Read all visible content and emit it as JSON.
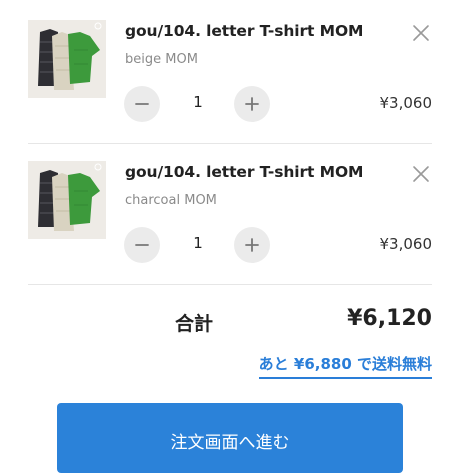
{
  "cart": {
    "items": [
      {
        "title": "gou/104. letter T-shirt MOM",
        "variant": "beige MOM",
        "quantity": "1",
        "price": "¥3,060",
        "image_icon": "product-thumbnail-tshirts"
      },
      {
        "title": "gou/104. letter T-shirt MOM",
        "variant": "charcoal MOM",
        "quantity": "1",
        "price": "¥3,060",
        "image_icon": "product-thumbnail-tshirts"
      }
    ],
    "remove_icon": "close-icon",
    "minus_icon": "minus-icon",
    "plus_icon": "plus-icon"
  },
  "summary": {
    "total_label": "合計",
    "total_amount": "¥6,120",
    "free_shipping_note": "あと ¥6,880 で送料無料"
  },
  "checkout": {
    "button_label": "注文画面へ進む"
  },
  "colors": {
    "accent_blue": "#2b82d9",
    "link_blue": "#2a7ed8",
    "button_gray": "#ebebeb",
    "shirt_green": "#3d9a3c",
    "shirt_charcoal": "#2e2e33",
    "shirt_beige": "#d9d3c1"
  }
}
